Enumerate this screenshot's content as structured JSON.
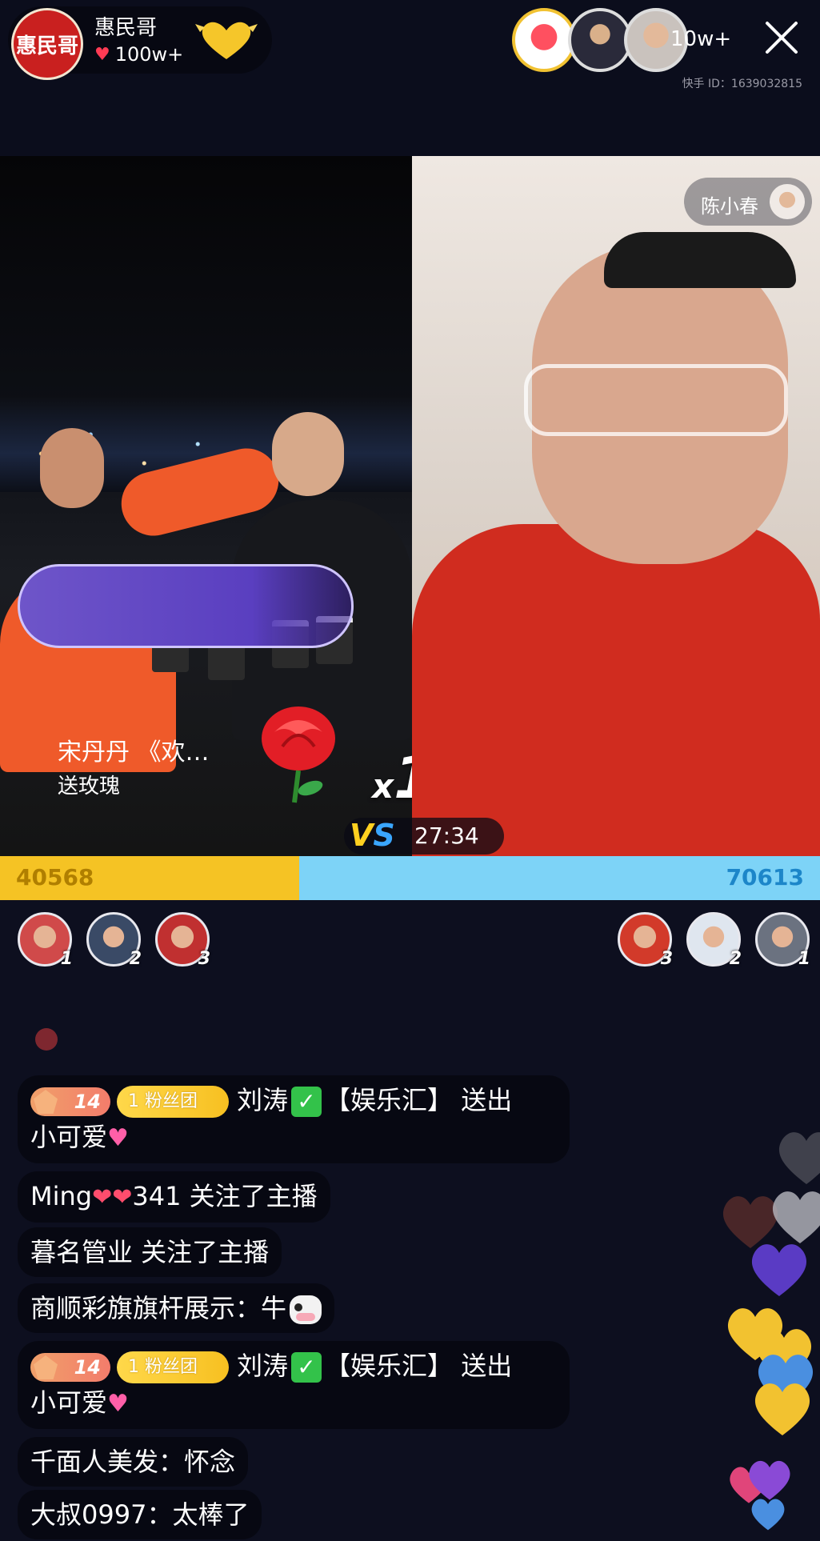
{
  "host": {
    "avatar_text": "惠民哥",
    "name": "惠民哥",
    "likes": "100w+"
  },
  "viewers": {
    "count": "10w+",
    "avatar_icons": [
      "host-heart-avatar",
      "viewer-avatar",
      "viewer-avatar"
    ]
  },
  "kuaishou_id": "快手 ID：1639032815",
  "opponent": {
    "name": "陈小春"
  },
  "gift": {
    "sender": "宋丹丹 《欢…",
    "action": "送玫瑰",
    "icon": "rose-icon",
    "multiplier_prefix": "x",
    "multiplier": "1"
  },
  "pk": {
    "vs_label": "VS",
    "timer": "27:34",
    "left_score": "40568",
    "right_score": "70613",
    "left_share": 0.365,
    "colors": {
      "left": "#f5c324",
      "right": "#7dd3f7"
    }
  },
  "contributors": {
    "left": [
      {
        "rank": "1"
      },
      {
        "rank": "2"
      },
      {
        "rank": "3"
      }
    ],
    "right": [
      {
        "rank": "3"
      },
      {
        "rank": "2"
      },
      {
        "rank": "1"
      }
    ]
  },
  "chat": [
    {
      "level": "14",
      "fan_badge": "1 粉丝团",
      "user": "刘涛",
      "text": "【娱乐汇】 送出",
      "line2": "小可爱"
    },
    {
      "user": "Ming",
      "suffix": "341 关注了主播"
    },
    {
      "text": "暮名管业 关注了主播"
    },
    {
      "text": "商顺彩旗旗杆展示：牛"
    },
    {
      "level": "14",
      "fan_badge": "1 粉丝团",
      "user": "刘涛",
      "text": "【娱乐汇】 送出",
      "line2": "小可爱"
    },
    {
      "text": "千面人美发：怀念"
    },
    {
      "text": "大叔0997：太棒了"
    }
  ]
}
